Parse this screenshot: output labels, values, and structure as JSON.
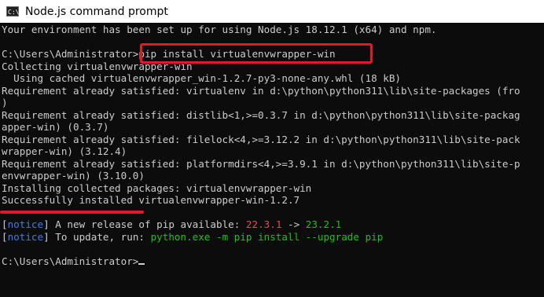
{
  "window": {
    "title": "Node.js command prompt",
    "icon_label": "C:\\"
  },
  "console": {
    "lines": [
      {
        "text": "Your environment has been set up for using Node.js 18.12.1 (x64) and npm."
      },
      {
        "text": ""
      },
      {
        "prompt": "C:\\Users\\Administrator>",
        "command": "pip install virtualenvwrapper-win"
      },
      {
        "text": "Collecting virtualenvwrapper-win"
      },
      {
        "text": "  Using cached virtualenvwrapper_win-1.2.7-py3-none-any.whl (18 kB)"
      },
      {
        "text": "Requirement already satisfied: virtualenv in d:\\python\\python311\\lib\\site-packages (fro"
      },
      {
        "text": ")"
      },
      {
        "text": "Requirement already satisfied: distlib<1,>=0.3.7 in d:\\python\\python311\\lib\\site-packag"
      },
      {
        "text": "apper-win) (0.3.7)"
      },
      {
        "text": "Requirement already satisfied: filelock<4,>=3.12.2 in d:\\python\\python311\\lib\\site-pack"
      },
      {
        "text": "wrapper-win) (3.12.4)"
      },
      {
        "text": "Requirement already satisfied: platformdirs<4,>=3.9.1 in d:\\python\\python311\\lib\\site-p"
      },
      {
        "text": "envwrapper-win) (3.10.0)"
      },
      {
        "text": "Installing collected packages: virtualenvwrapper-win"
      },
      {
        "text": "Successfully installed virtualenvwrapper-win-1.2.7"
      },
      {
        "text": ""
      },
      {
        "notice_tag": "notice",
        "before": " A new release of pip available: ",
        "old_version": "22.3.1",
        "arrow": " -> ",
        "new_version": "23.2.1"
      },
      {
        "notice_tag": "notice",
        "before": " To update, run: ",
        "update_command": "python.exe -m pip install --upgrade pip"
      },
      {
        "text": ""
      },
      {
        "prompt": "C:\\Users\\Administrator>"
      }
    ]
  },
  "colors": {
    "highlight": "#e11a2b",
    "notice": "#3b78ff",
    "old_version": "#e74856",
    "new_version": "#16c60c"
  }
}
